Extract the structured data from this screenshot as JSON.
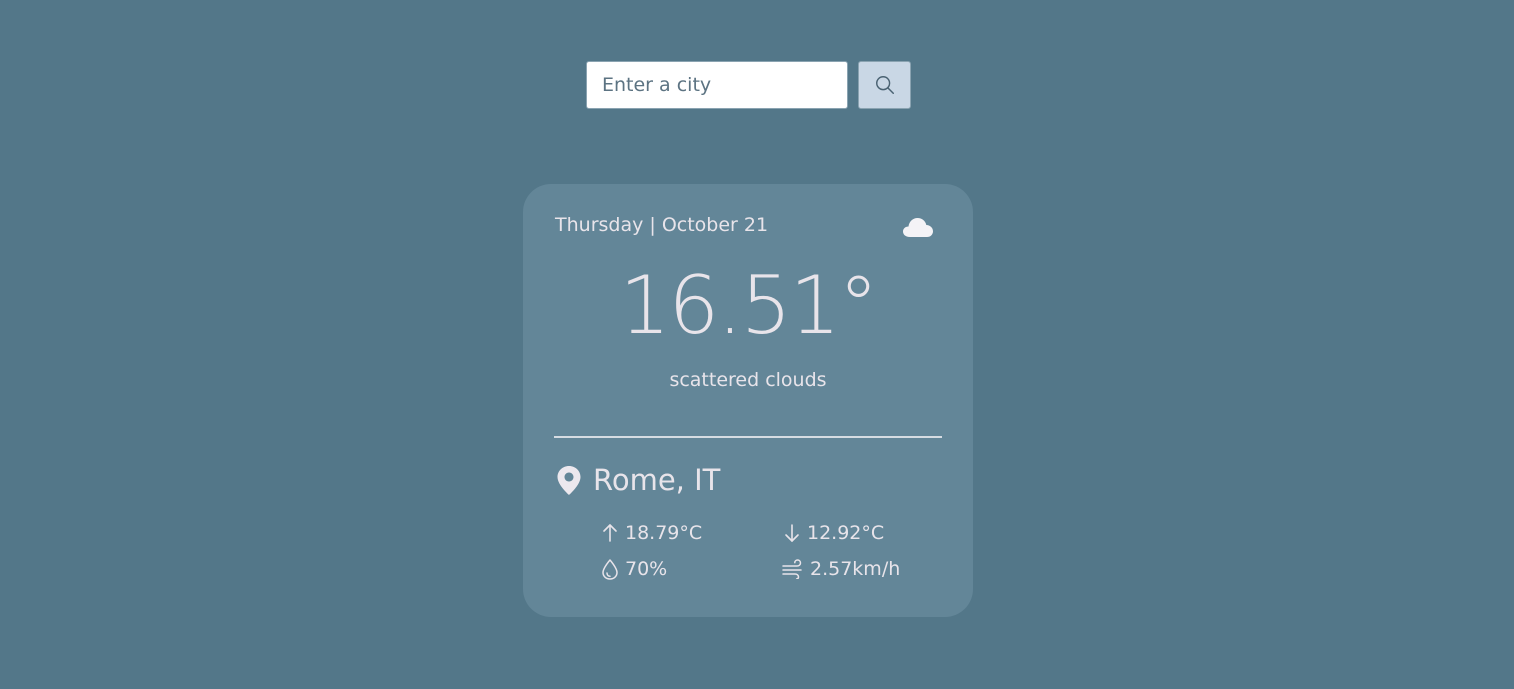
{
  "search": {
    "placeholder": "Enter a city",
    "button_icon": "search-icon"
  },
  "weather": {
    "date": "Thursday | October 21",
    "condition_icon": "cloud-icon",
    "temperature": "16.51°",
    "description": "scattered clouds",
    "location_icon": "map-pin-icon",
    "location": "Rome, IT",
    "stats": {
      "temp_max": {
        "icon": "arrow-up-icon",
        "value": "18.79°C"
      },
      "temp_min": {
        "icon": "arrow-down-icon",
        "value": "12.92°C"
      },
      "humidity": {
        "icon": "droplet-icon",
        "value": "70%"
      },
      "wind": {
        "icon": "wind-icon",
        "value": "2.57km/h"
      }
    }
  },
  "colors": {
    "background": "#537789",
    "card": "#638698",
    "text": "#e8e4ea",
    "search_button": "#c9d7e5"
  }
}
